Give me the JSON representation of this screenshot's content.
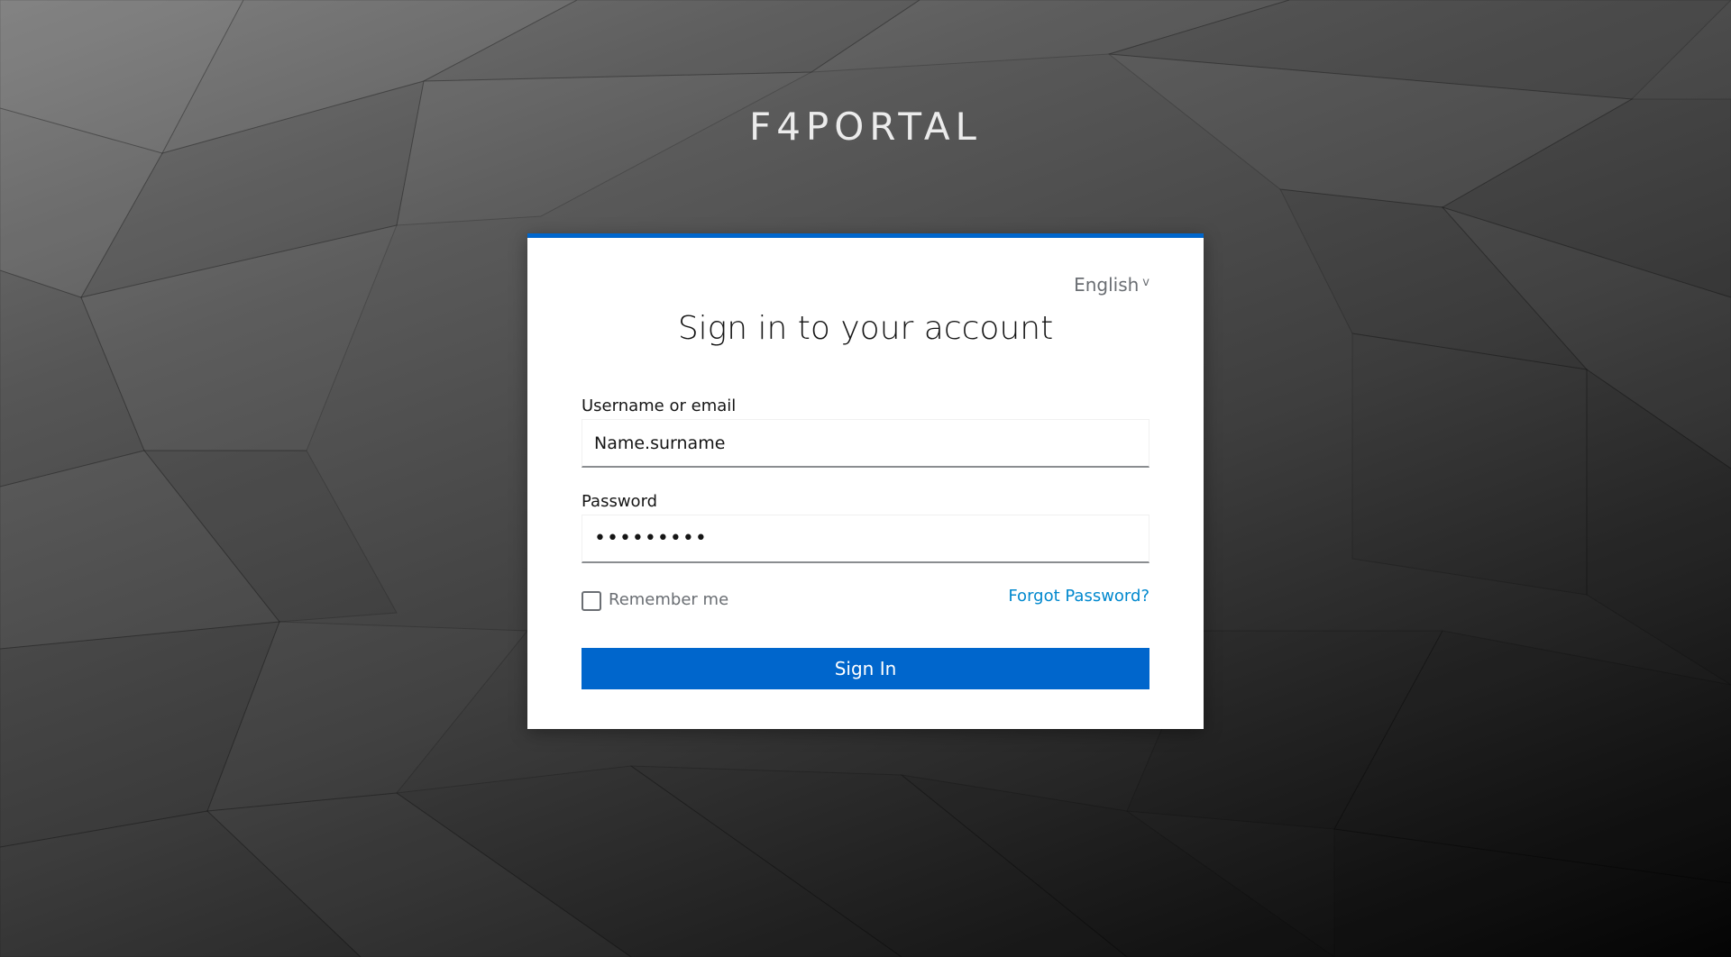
{
  "brand": {
    "name": "F4PORTAL"
  },
  "login": {
    "language": "English",
    "title": "Sign in to your account",
    "username_label": "Username or email",
    "username_value": "Name.surname",
    "password_label": "Password",
    "password_value": "•••••••••",
    "remember_label": "Remember me",
    "remember_checked": false,
    "forgot_label": "Forgot Password?",
    "signin_label": "Sign In"
  },
  "icons": {
    "language_chevron": "chevron-down-icon"
  },
  "colors": {
    "accent": "#0066cc",
    "link": "#0088ce",
    "background_dark": "#050505",
    "background_light": "#7c7c7c"
  }
}
